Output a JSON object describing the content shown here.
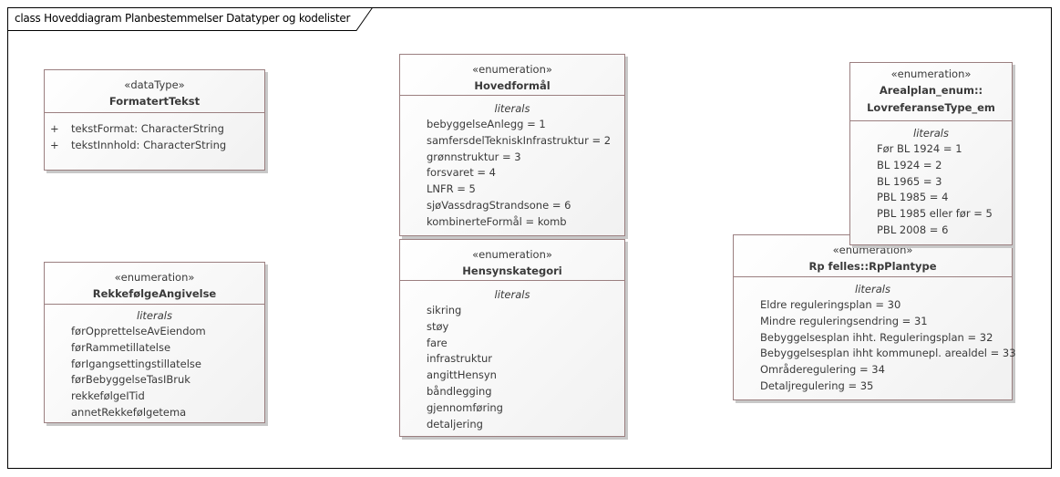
{
  "diagram": {
    "title": "class Hoveddiagram Planbestemmelser Datatyper og kodelister"
  },
  "classes": {
    "formatertTekst": {
      "stereotype": "«dataType»",
      "name": "FormatertTekst",
      "attributes": [
        {
          "visibility": "+",
          "text": "tekstFormat: CharacterString"
        },
        {
          "visibility": "+",
          "text": "tekstInnhold: CharacterString"
        }
      ]
    },
    "rekkefolgeAngivelse": {
      "stereotype": "«enumeration»",
      "name": "RekkefølgeAngivelse",
      "section": "literals",
      "literals": [
        "førOpprettelseAvEiendom",
        "førRammetillatelse",
        "førIgangsettingstillatelse",
        "førBebyggelseTasIBruk",
        "rekkefølgeITid",
        "annetRekkefølgetema"
      ]
    },
    "hovedformal": {
      "stereotype": "«enumeration»",
      "name": "Hovedformål",
      "section": "literals",
      "literals": [
        "bebyggelseAnlegg = 1",
        "samfersdelTekniskInfrastruktur = 2",
        "grønnstruktur = 3",
        "forsvaret = 4",
        "LNFR = 5",
        "sjøVassdragStrandsone = 6",
        "kombinerteFormål = komb"
      ]
    },
    "hensynskategori": {
      "stereotype": "«enumeration»",
      "name": "Hensynskategori",
      "section": "literals",
      "literals": [
        "sikring",
        "støy",
        "fare",
        "infrastruktur",
        "angittHensyn",
        "båndlegging",
        "gjennomføring",
        "detaljering"
      ]
    },
    "lovreferanseType": {
      "stereotype": "«enumeration»",
      "name_line1": "Arealplan_enum::",
      "name_line2": "LovreferanseType_em",
      "section": "literals",
      "literals": [
        "Før BL 1924 = 1",
        "BL 1924 = 2",
        "BL 1965 = 3",
        "PBL 1985 = 4",
        "PBL 1985 eller før = 5",
        "PBL 2008 = 6"
      ]
    },
    "rpPlantype": {
      "stereotype": "«enumeration»",
      "name": "Rp felles::RpPlantype",
      "section": "literals",
      "literals": [
        "Eldre reguleringsplan = 30",
        "Mindre reguleringsendring = 31",
        "Bebyggelsesplan ihht. Reguleringsplan = 32",
        "Bebyggelsesplan ihht kommunepl. arealdel = 33",
        "Områderegulering = 34",
        "Detaljregulering = 35"
      ]
    }
  }
}
